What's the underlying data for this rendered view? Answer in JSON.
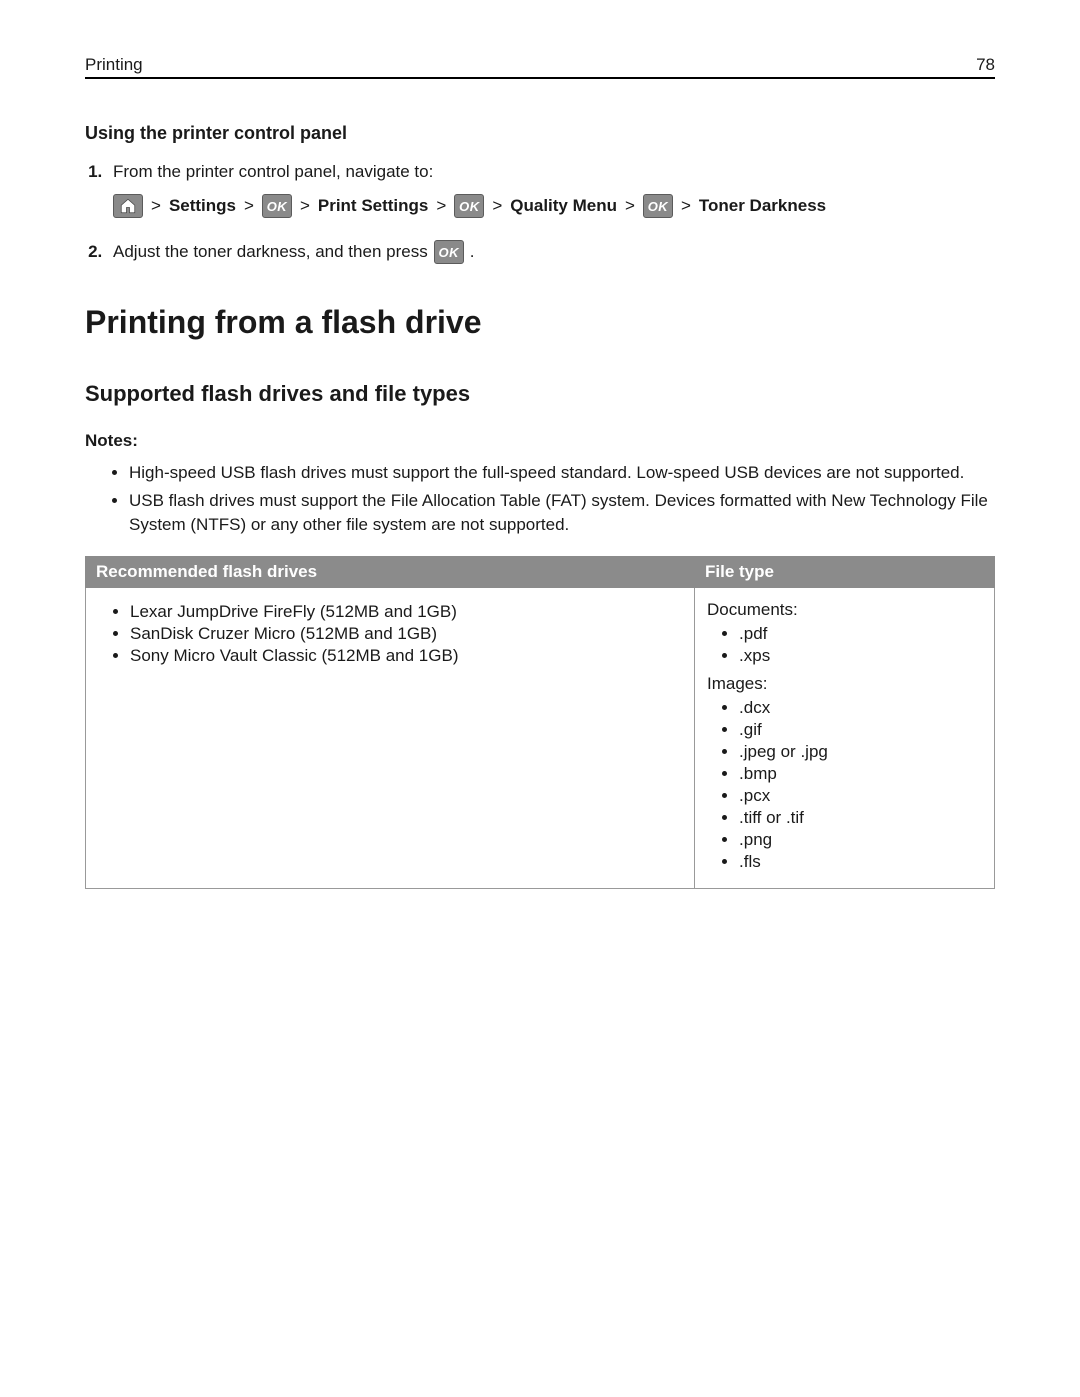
{
  "header": {
    "section": "Printing",
    "page_number": "78"
  },
  "section1": {
    "heading": "Using the printer control panel",
    "step1_text": "From the printer control panel, navigate to:",
    "nav": {
      "sep": ">",
      "settings": "Settings",
      "print_settings": "Print Settings",
      "quality_menu": "Quality Menu",
      "toner_darkness": "Toner Darkness",
      "ok_label": "OK"
    },
    "step2_before": "Adjust the toner darkness, and then press",
    "step2_after": "."
  },
  "section2": {
    "heading": "Printing from a flash drive",
    "subheading": "Supported flash drives and file types",
    "notes_label": "Notes:",
    "notes": [
      "High‑speed USB flash drives must support the full‑speed standard. Low‑speed USB devices are not supported.",
      "USB flash drives must support the File Allocation Table (FAT) system. Devices formatted with New Technology File System (NTFS) or any other file system are not supported."
    ],
    "table": {
      "col1_header": "Recommended flash drives",
      "col2_header": "File type",
      "drives": [
        "Lexar JumpDrive FireFly (512MB and 1GB)",
        "SanDisk Cruzer Micro (512MB and 1GB)",
        "Sony Micro Vault Classic (512MB and 1GB)"
      ],
      "documents_label": "Documents:",
      "documents": [
        ".pdf",
        ".xps"
      ],
      "images_label": "Images:",
      "images": [
        ".dcx",
        ".gif",
        ".jpeg or .jpg",
        ".bmp",
        ".pcx",
        ".tiff or .tif",
        ".png",
        ".fls"
      ]
    }
  }
}
